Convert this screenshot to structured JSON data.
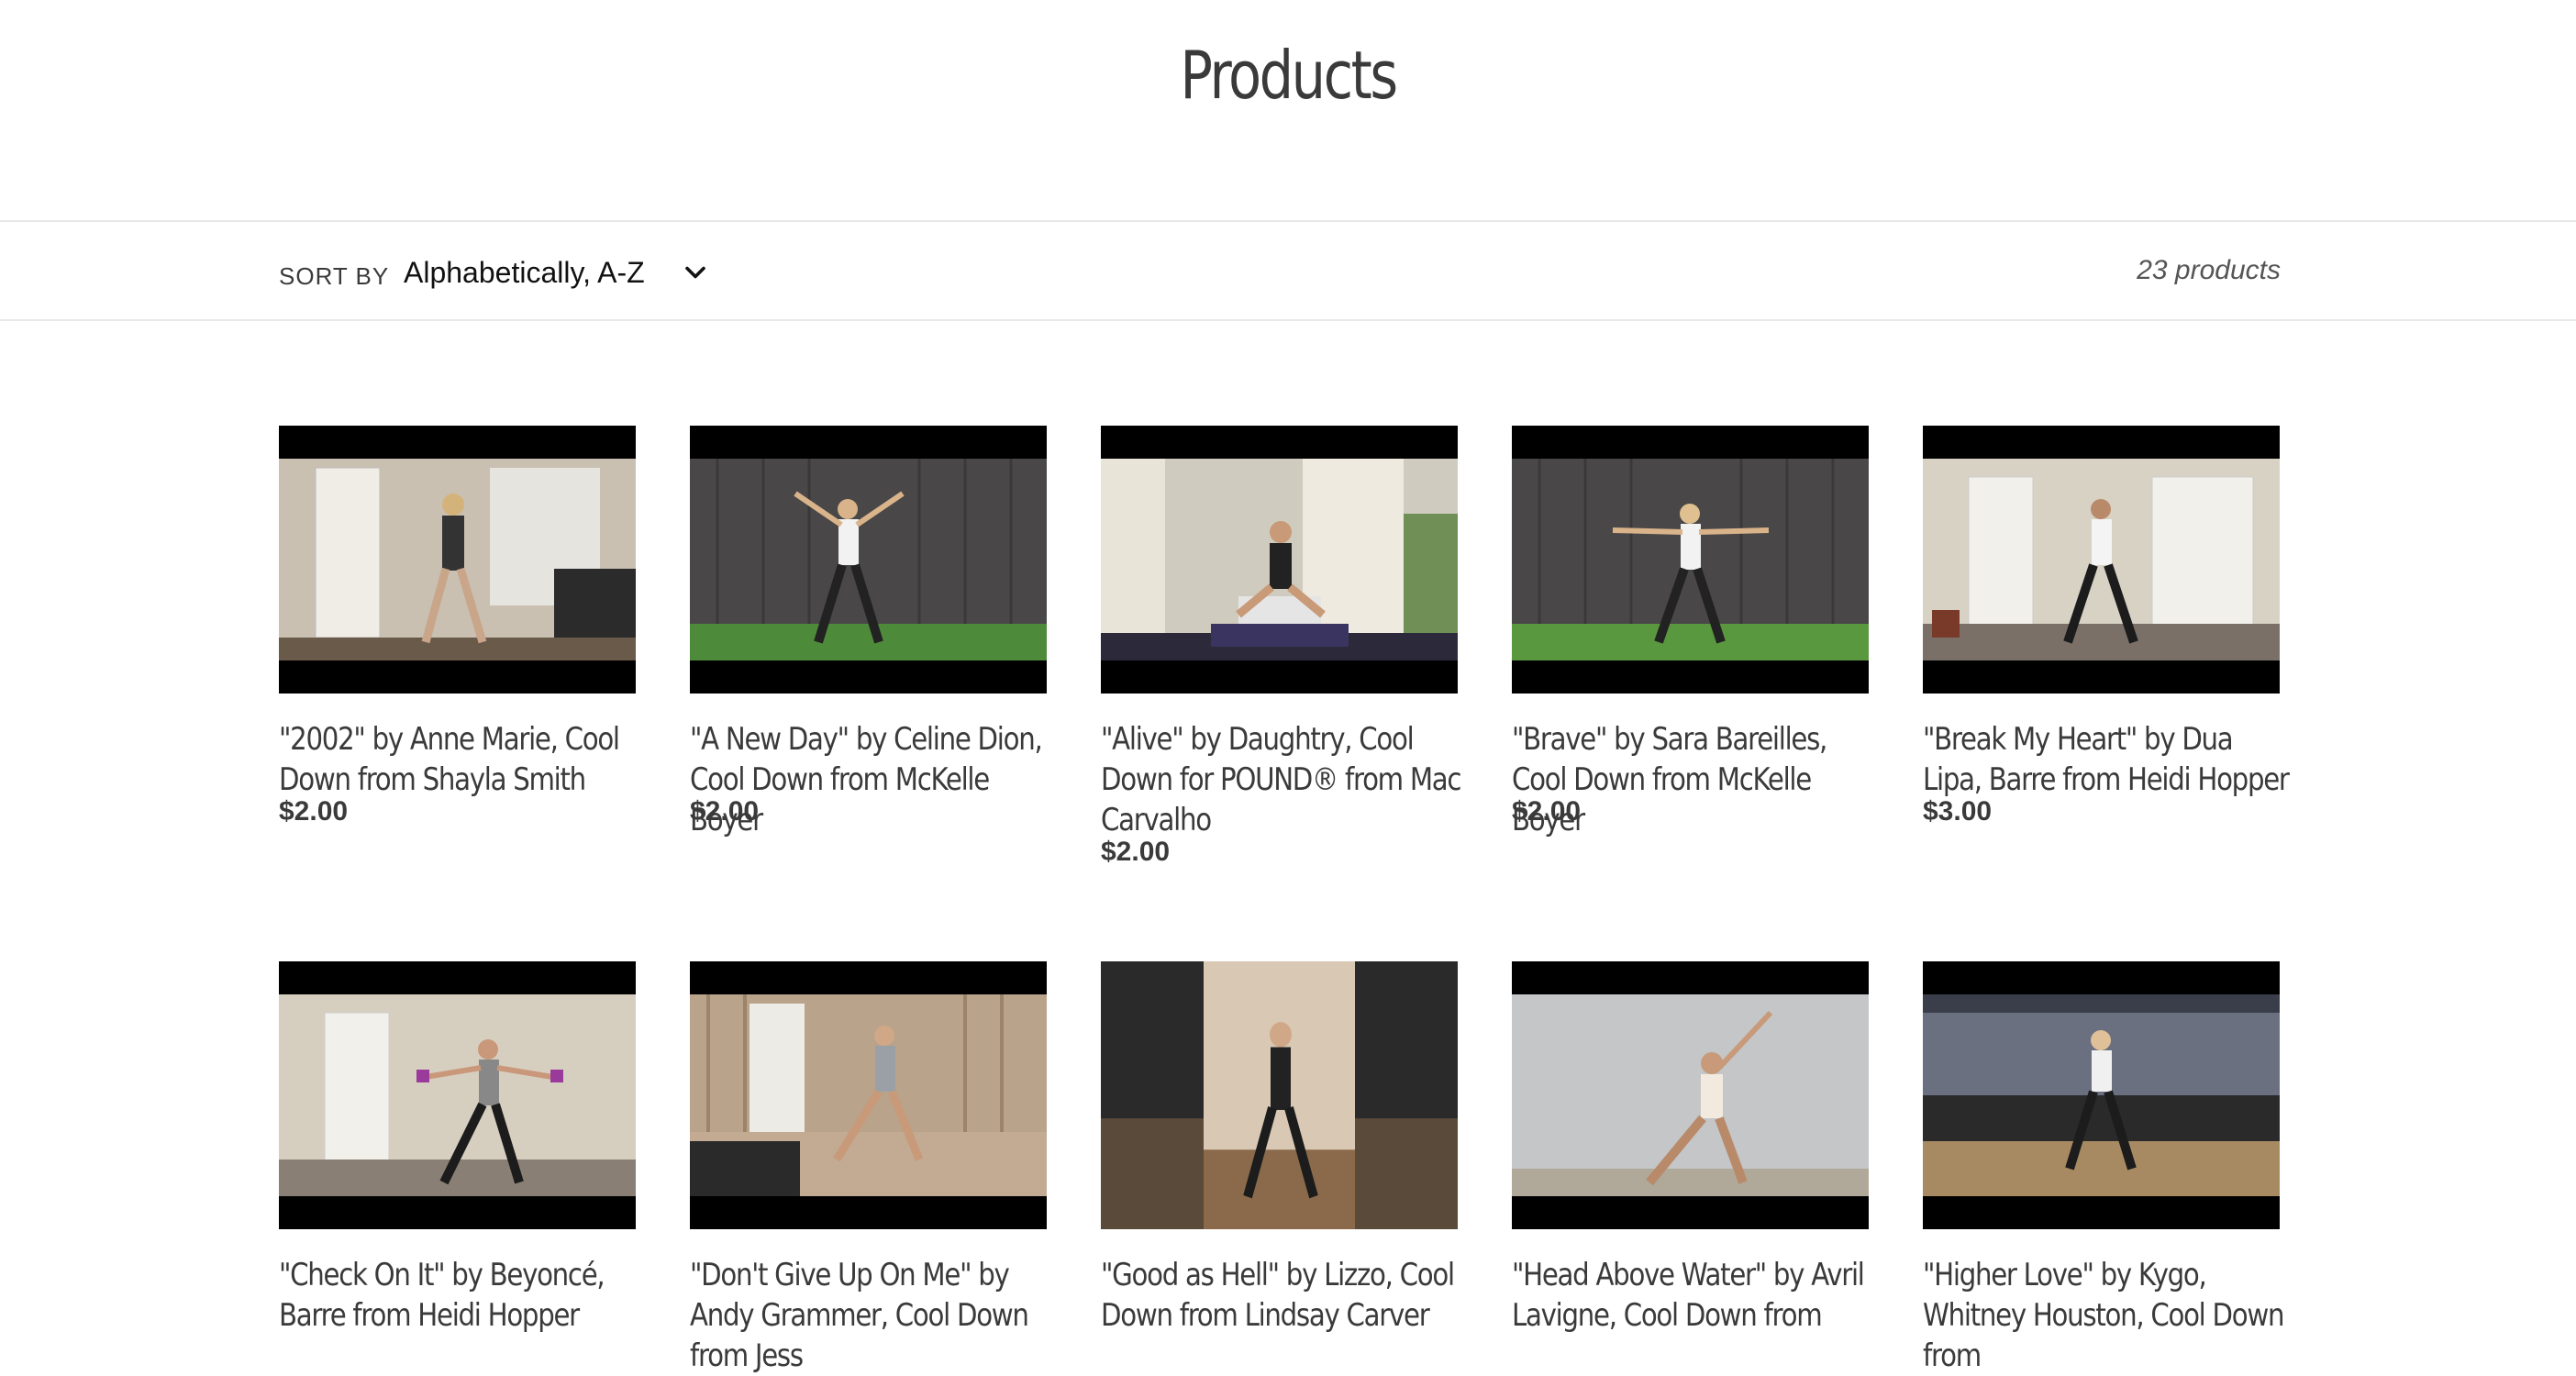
{
  "page": {
    "title": "Products"
  },
  "filter": {
    "sort_label": "Sort by",
    "sort_value": "Alphabetically, A-Z",
    "count": "23 products"
  },
  "icons": {
    "sort_chevron": "chevron-down-icon"
  },
  "products": [
    {
      "title": "\"2002\" by Anne Marie, Cool Down from Shayla Smith",
      "price": "$2.00"
    },
    {
      "title": "\"A New Day\" by Celine Dion, Cool Down from McKelle Boyer",
      "price": "$2.00"
    },
    {
      "title": "\"Alive\" by Daughtry, Cool Down for POUND® from Mac Carvalho",
      "price": "$2.00"
    },
    {
      "title": "\"Brave\" by Sara Bareilles, Cool Down from McKelle Boyer",
      "price": "$2.00"
    },
    {
      "title": "\"Break My Heart\" by Dua Lipa, Barre from Heidi Hopper",
      "price": "$3.00"
    },
    {
      "title": "\"Check On It\" by Beyoncé, Barre from Heidi Hopper",
      "price": ""
    },
    {
      "title": "\"Don't Give Up On Me\" by Andy Grammer, Cool Down from Jess",
      "price": ""
    },
    {
      "title": "\"Good as Hell\" by Lizzo, Cool Down from Lindsay Carver",
      "price": ""
    },
    {
      "title": "\"Head Above Water\" by Avril Lavigne, Cool Down from",
      "price": ""
    },
    {
      "title": "\"Higher Love\" by Kygo, Whitney Houston, Cool Down from",
      "price": ""
    }
  ]
}
